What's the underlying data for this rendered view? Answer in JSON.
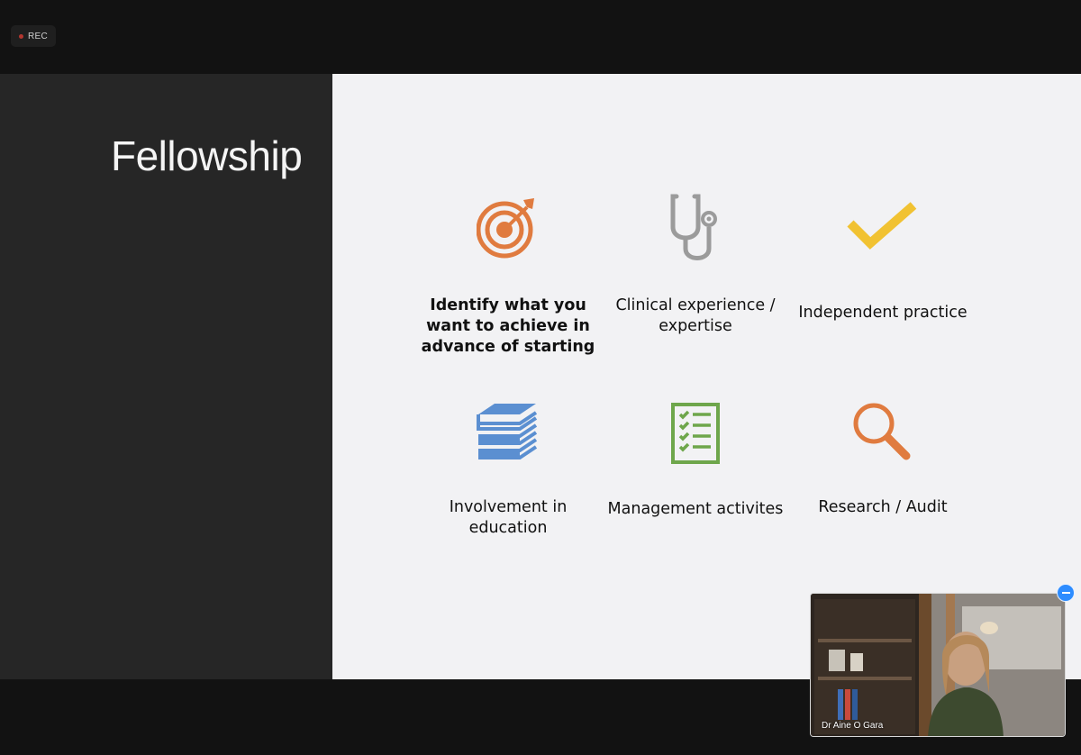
{
  "meeting": {
    "rec_label": "REC",
    "participant_name": "Dr Aine O Gara"
  },
  "slide": {
    "title": "Fellowship",
    "items": [
      {
        "icon": "target-icon",
        "label": "Identify what you want to achieve in advance of starting",
        "bold": true,
        "color": "#e07b3f"
      },
      {
        "icon": "stethoscope-icon",
        "label": "Clinical experience / expertise",
        "bold": false,
        "color": "#9b9b9b"
      },
      {
        "icon": "checkmark-icon",
        "label": "Independent practice",
        "bold": false,
        "color": "#f1c232"
      },
      {
        "icon": "books-icon",
        "label": "Involvement in education",
        "bold": false,
        "color": "#5b8fd1"
      },
      {
        "icon": "checklist-icon",
        "label": "Management activites",
        "bold": false,
        "color": "#6ea64b"
      },
      {
        "icon": "magnifier-icon",
        "label": "Research / Audit",
        "bold": false,
        "color": "#e07b3f"
      }
    ]
  }
}
